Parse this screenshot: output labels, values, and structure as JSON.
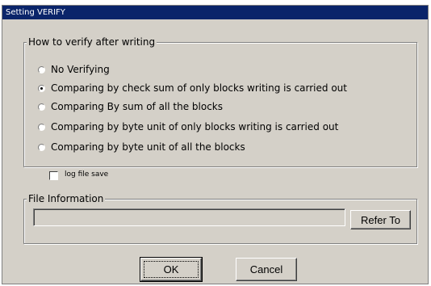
{
  "window": {
    "title": "Setting VERIFY"
  },
  "verify_group": {
    "legend": "How to verify after writing",
    "options": [
      {
        "label": "No Verifying",
        "selected": false
      },
      {
        "label": "Comparing by check sum of only blocks writing is carried out",
        "selected": true
      },
      {
        "label": "Comparing By sum of all the blocks",
        "selected": false
      },
      {
        "label": "Comparing by byte unit of only blocks writing is carried out",
        "selected": false
      },
      {
        "label": "Comparing by byte unit of all the blocks",
        "selected": false
      }
    ]
  },
  "log_file": {
    "label": "log file save",
    "checked": false
  },
  "file_info": {
    "legend": "File Information",
    "path_value": "",
    "refer_button": "Refer To"
  },
  "buttons": {
    "ok": "OK",
    "cancel": "Cancel"
  },
  "colors": {
    "titlebar": "#0a246a",
    "face": "#d4d0c8"
  }
}
